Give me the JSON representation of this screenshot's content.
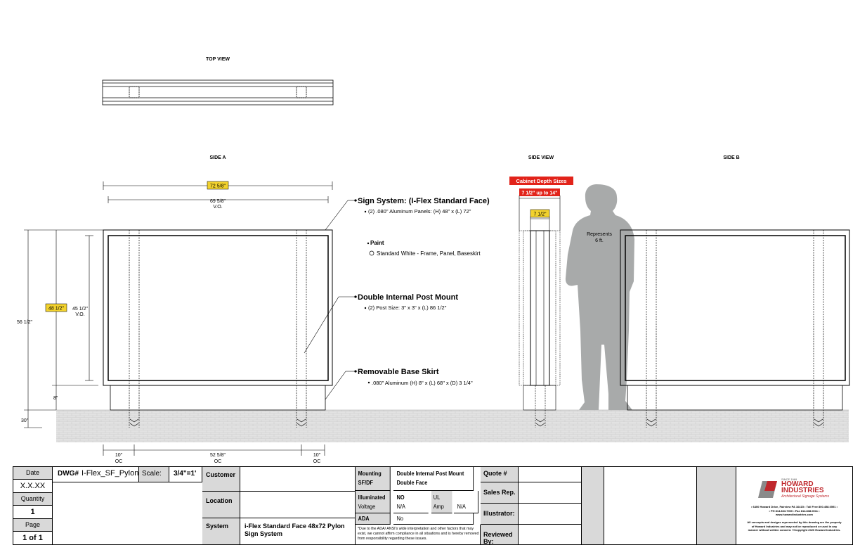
{
  "views": {
    "top": "TOP VIEW",
    "side_a": "SIDE A",
    "side_view": "SIDE VIEW",
    "side_b": "SIDE B"
  },
  "dimensions": {
    "overall_width": "72 5/8\"",
    "vo_width": "69 5/8\"",
    "vo_width_sub": "V.O.",
    "overall_height": "56 1/2\"",
    "cabinet_height": "48 1/2\"",
    "vo_height": "45 1/2\"",
    "vo_height_sub": "V.O.",
    "skirt_height": "8\"",
    "ground_depth": "30\"",
    "left_oc": "10\"",
    "center_oc": "52 5/8\"",
    "right_oc": "10\"",
    "oc_sub": "OC"
  },
  "side_view": {
    "depth_title": "Cabinet Depth Sizes",
    "depth_range": "7 1/2\" up to 14\"",
    "depth_value": "7 1/2\"",
    "person_label_1": "Represents",
    "person_label_2": "6 ft."
  },
  "callouts": {
    "sign_system_title": "Sign System: (I-Flex Standard Face)",
    "sign_system_detail": "(2) .080\" Aluminum Panels: (H) 48\" x (L) 72\"",
    "paint_title": "Paint",
    "paint_detail": "Standard White - Frame, Panel, Baseskirt",
    "post_title": "Double Internal Post Mount",
    "post_detail": "(2) Post Size: 3\" x 3\" x (L) 86 1/2\"",
    "skirt_title": "Removable Base Skirt",
    "skirt_detail": ".080\" Aluminum (H) 8\" x (L) 68\" x (D) 3 1/4\""
  },
  "title_block": {
    "date_label": "Date",
    "date_value": "X.X.XX",
    "quantity_label": "Quantity",
    "quantity_value": "1",
    "page_label": "Page",
    "page_value": "1 of 1",
    "dwg_label": "DWG#",
    "dwg_value": "I-Flex_SF_Pylon",
    "scale_label": "Scale:",
    "scale_value": "3/4\"=1'",
    "customer_label": "Customer",
    "location_label": "Location",
    "system_label": "System",
    "system_value_1": "i-Flex Standard Face 48x72 Pylon",
    "system_value_2": "Sign System",
    "mounting_label": "Mounting",
    "mounting_value": "Double Internal Post Mount",
    "sfdf_label": "SF/DF",
    "sfdf_value": "Double Face",
    "illuminated_label": "Illuminated",
    "illuminated_value": "NO",
    "ul_label": "UL",
    "voltage_label": "Voltage",
    "voltage_value": "N/A",
    "amp_label": "Amp",
    "amp_value": "N/A",
    "ada_label": "ADA",
    "ada_value": "No",
    "disclaimer_1": "*Due to the ADA/ ANSI's wide interpretation and other factors that may",
    "disclaimer_2": "exist, we cannot affirm compliance in all situations and is hereby removed",
    "disclaimer_3": "from responsibility regarding these issues.",
    "quote_label": "Quote #",
    "sales_label": "Sales Rep.",
    "illustrator_label": "Illustrator:",
    "reviewed_label": "Reviewed By:"
  },
  "company": {
    "since": "SINCE 1969",
    "name_1": "HOWARD",
    "name_2": "INDUSTRIES",
    "tagline": "Architectural Signage Systems",
    "address_1": "• 6400 Howard Drive, Fairview PA 16415 • Toll Free 800.458.0591 •",
    "address_2": "• PH 814.833.7000 • Fax 814.838.0011 •",
    "web": "www.howardindustries.com",
    "legal_1": "All concepts and designs represented by this drawing are the property",
    "legal_2": "of Howard Industries and may not be reproduced or used in any",
    "legal_3": "manner without written consent. ©Copyright 2020 Howard Industries.",
    "brand_color": "#c0282d"
  },
  "colors": {
    "highlight_yellow": "#f2d22e",
    "callout_red": "#e2231a",
    "silhouette_gray": "#a8aaaa",
    "ground_gray": "#dedede"
  }
}
